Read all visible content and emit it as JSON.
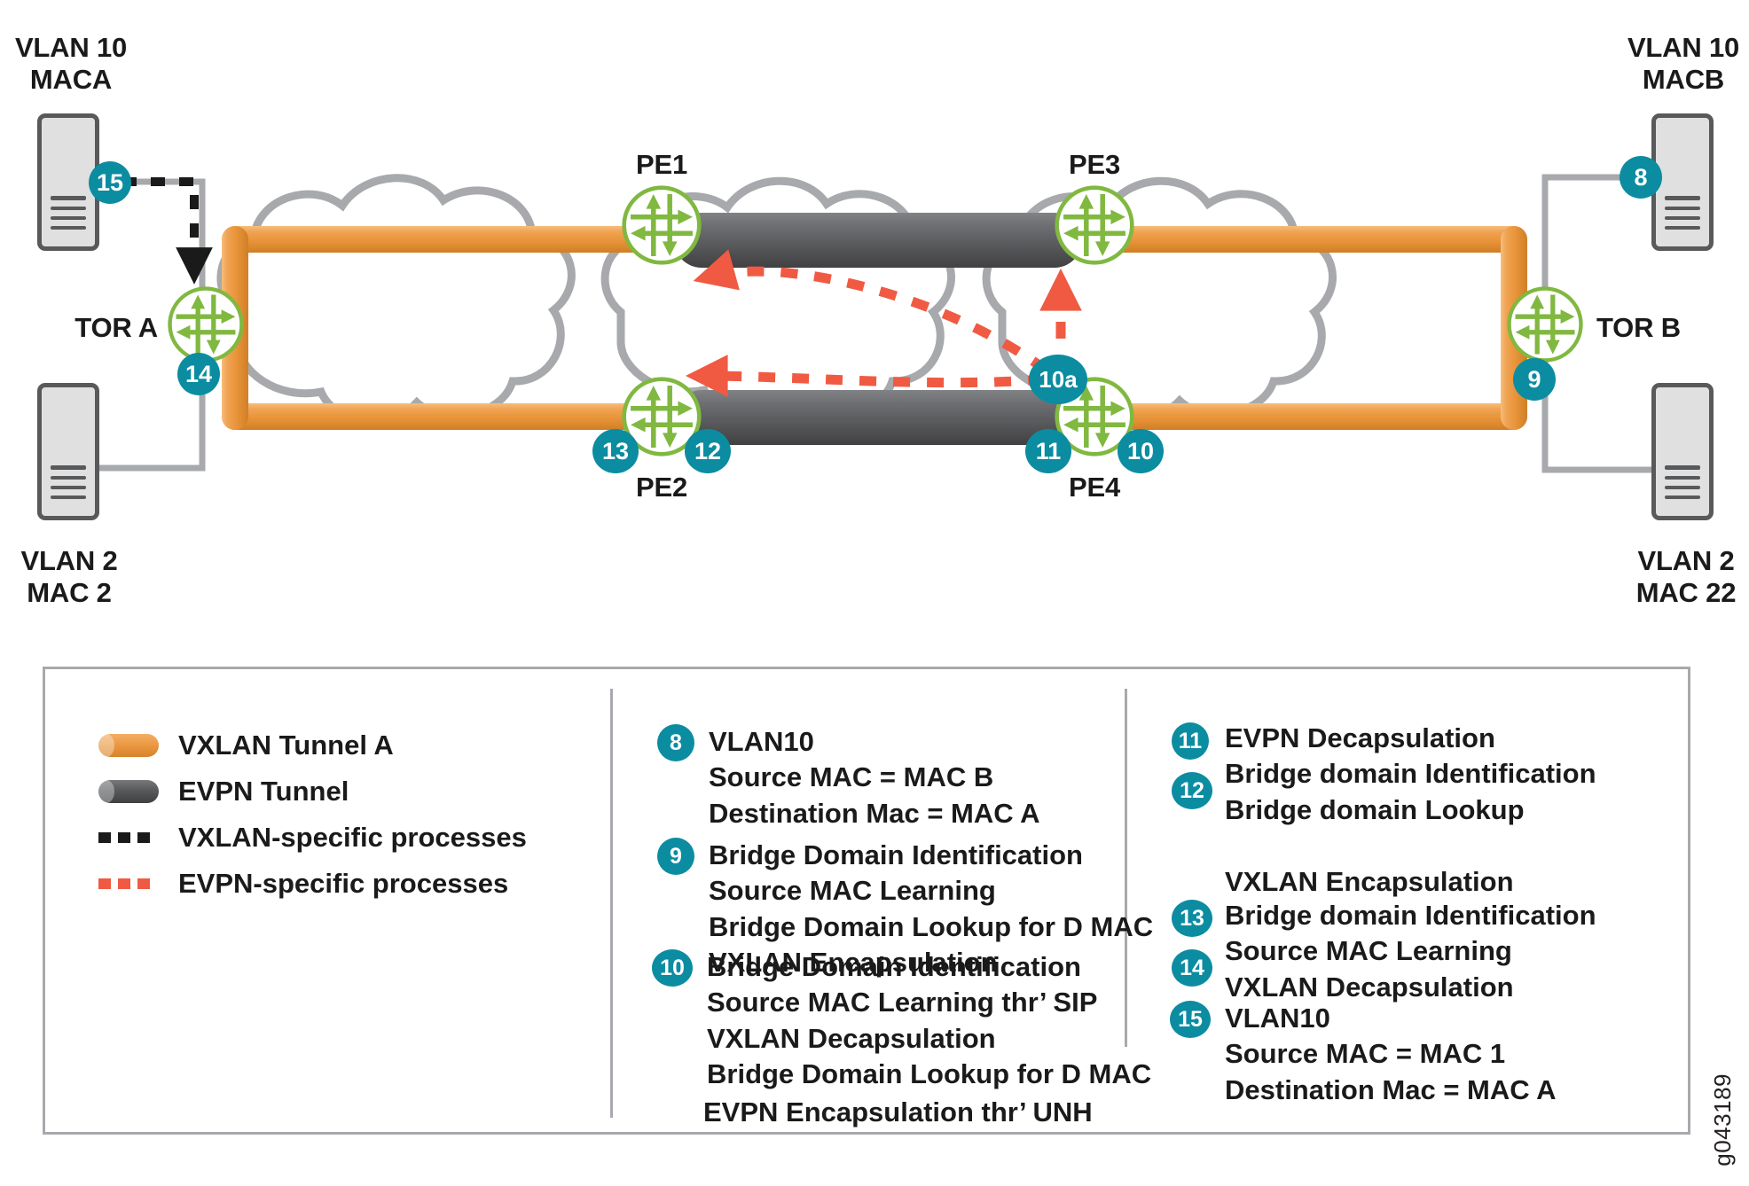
{
  "diagram": {
    "hosts": {
      "top_left": {
        "line1": "VLAN 10",
        "line2": "MACA"
      },
      "bottom_left": {
        "line1": "VLAN 2",
        "line2": "MAC 2"
      },
      "top_right": {
        "line1": "VLAN 10",
        "line2": "MACB"
      },
      "bottom_right": {
        "line1": "VLAN 2",
        "line2": "MAC 22"
      }
    },
    "nodes": {
      "tor_a": "TOR A",
      "tor_b": "TOR B",
      "pe1": "PE1",
      "pe2": "PE2",
      "pe3": "PE3",
      "pe4": "PE4"
    },
    "step_badges": {
      "host_a_15": "15",
      "tor_a_14": "14",
      "pe2_13": "13",
      "pe2_12": "12",
      "pe4_11": "11",
      "pe4_10": "10",
      "pe4_10a": "10a",
      "tor_b_9": "9",
      "host_b_8": "8"
    }
  },
  "legend": {
    "keys": [
      {
        "icon": "orange-tunnel-swatch",
        "label": "VXLAN Tunnel A"
      },
      {
        "icon": "gray-tunnel-swatch",
        "label": "EVPN Tunnel"
      },
      {
        "icon": "black-dashed-swatch",
        "label": "VXLAN-specific processes"
      },
      {
        "icon": "red-dashed-swatch",
        "label": "EVPN-specific processes"
      }
    ],
    "middle_column": [
      {
        "number": "8",
        "lines": [
          "VLAN10",
          "Source MAC = MAC B",
          "Destination Mac = MAC A"
        ]
      },
      {
        "number": "9",
        "lines": [
          "Bridge Domain Identification",
          "Source MAC Learning",
          "Bridge Domain Lookup for D MAC",
          "VXLAN Encapsulation"
        ]
      },
      {
        "number": "10",
        "lines": [
          "Bridge Domain Identification",
          "Source MAC Learning thr’ SIP",
          "VXLAN Decapsulation",
          "Bridge Domain Lookup for D MAC"
        ]
      },
      {
        "number": "",
        "lines": [
          "EVPN Encapsulation thr’ UNH"
        ]
      }
    ],
    "right_column": [
      {
        "numbers": [
          "11",
          "12"
        ],
        "lines": [
          "EVPN Decapsulation",
          "Bridge domain Identification",
          "Bridge domain Lookup"
        ]
      },
      {
        "numbers": [],
        "lines": [
          "VXLAN Encapsulation"
        ]
      },
      {
        "numbers": [
          "13",
          "14"
        ],
        "lines": [
          "Bridge domain Identification",
          "Source MAC Learning",
          "VXLAN Decapsulation"
        ]
      },
      {
        "numbers": [
          "15"
        ],
        "lines": [
          "VLAN10",
          "Source MAC = MAC 1",
          "Destination Mac = MAC A"
        ]
      }
    ]
  },
  "watermark": "g043189",
  "colors": {
    "vxlan_tunnel": "#eb9a43",
    "evpn_tunnel": "#58595b",
    "badge_teal": "#0b8ca1",
    "router_green": "#80b840",
    "cloud_gray": "#a7a9ac",
    "evpn_dash_red": "#f05a43",
    "vxlan_dash_black": "#1a1a1a"
  }
}
